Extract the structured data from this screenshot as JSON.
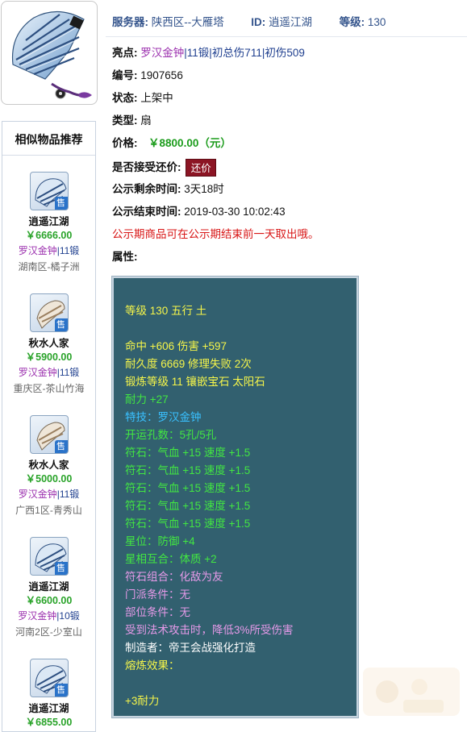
{
  "header": {
    "server_label": "服务器:",
    "server_value": "陕西区--大雁塔",
    "id_label": "ID:",
    "id_value": "逍遥江湖",
    "level_label": "等级:",
    "level_value": "130"
  },
  "details": {
    "highlight_label": "亮点:",
    "highlight_parts": [
      "罗汉金钟",
      "|",
      "11锻",
      "|",
      "初总伤711",
      "|",
      "初伤509"
    ],
    "number_label": "编号:",
    "number_value": "1907656",
    "status_label": "状态:",
    "status_value": "上架中",
    "type_label": "类型:",
    "type_value": "扇",
    "price_label": "价格:",
    "price_value": "￥8800.00（元）",
    "bargain_label": "是否接受还价:",
    "bargain_button": "还价",
    "remaining_label": "公示剩余时间:",
    "remaining_value": "3天18时",
    "end_label": "公示结束时间:",
    "end_value": "2019-03-30 10:02:43",
    "notice": "公示期商品可在公示期结束前一天取出哦。",
    "attr_label": "属性:"
  },
  "attributes": [
    {
      "text": "等级 130 五行 土",
      "color": "yellow"
    },
    {
      "text": "命中 +606 伤害 +597",
      "color": "yellow"
    },
    {
      "text": "耐久度 6669 修理失败 2次",
      "color": "yellow"
    },
    {
      "text": "锻炼等级 11 镶嵌宝石 太阳石",
      "color": "yellow"
    },
    {
      "text": "耐力 +27",
      "color": "green"
    },
    {
      "text": "特技：罗汉金钟",
      "color": "cyan"
    },
    {
      "text": "开运孔数：5孔/5孔",
      "color": "green"
    },
    {
      "text": "符石：气血 +15 速度 +1.5",
      "color": "green"
    },
    {
      "text": "符石：气血 +15 速度 +1.5",
      "color": "green"
    },
    {
      "text": "符石：气血 +15 速度 +1.5",
      "color": "green"
    },
    {
      "text": "符石：气血 +15 速度 +1.5",
      "color": "green"
    },
    {
      "text": "符石：气血 +15 速度 +1.5",
      "color": "green"
    },
    {
      "text": "星位：防御 +4",
      "color": "green"
    },
    {
      "text": "星相互合：体质 +2",
      "color": "green"
    },
    {
      "text": "符石组合：化敌为友",
      "color": "pink"
    },
    {
      "text": "门派条件：无",
      "color": "pink"
    },
    {
      "text": "部位条件：无",
      "color": "pink"
    },
    {
      "text": "受到法术攻击时，降低3%所受伤害",
      "color": "pink"
    },
    {
      "text": "制造者：帝王会战强化打造",
      "color": "white"
    },
    {
      "text": "熔炼效果：",
      "color": "yellow"
    },
    {
      "text": "+3耐力",
      "color": "yellow"
    }
  ],
  "recommend": {
    "title": "相似物品推荐",
    "sell_tag": "售",
    "items": [
      {
        "name": "逍遥江湖",
        "price": "￥6666.00",
        "skill": "罗汉金钟",
        "sep": "|",
        "forge": "11锻",
        "server": "湖南区-橘子洲",
        "icon": "fan-icon"
      },
      {
        "name": "秋水人家",
        "price": "￥5900.00",
        "skill": "罗汉金钟",
        "sep": "|",
        "forge": "11锻",
        "server": "重庆区-茶山竹海",
        "icon": "fan-icon"
      },
      {
        "name": "秋水人家",
        "price": "￥5000.00",
        "skill": "罗汉金钟",
        "sep": "|",
        "forge": "11锻",
        "server": "广西1区-青秀山",
        "icon": "fan-icon"
      },
      {
        "name": "逍遥江湖",
        "price": "￥6600.00",
        "skill": "罗汉金钟",
        "sep": "|",
        "forge": "10锻",
        "server": "河南2区-少室山",
        "icon": "fan-icon"
      },
      {
        "name": "逍遥江湖",
        "price": "￥6855.00",
        "skill": "",
        "sep": "",
        "forge": "",
        "server": "",
        "icon": "fan-icon"
      }
    ]
  },
  "colors": {
    "attr_bg": "#32606f",
    "yellow": "#f5f54a",
    "green": "#42e642",
    "cyan": "#39c0ff",
    "pink": "#e79ae9",
    "white": "#ffffff",
    "price_green": "#29a329",
    "notice_red": "#d81515",
    "header_blue": "#34548c",
    "bargain_bg": "#8c1524"
  }
}
